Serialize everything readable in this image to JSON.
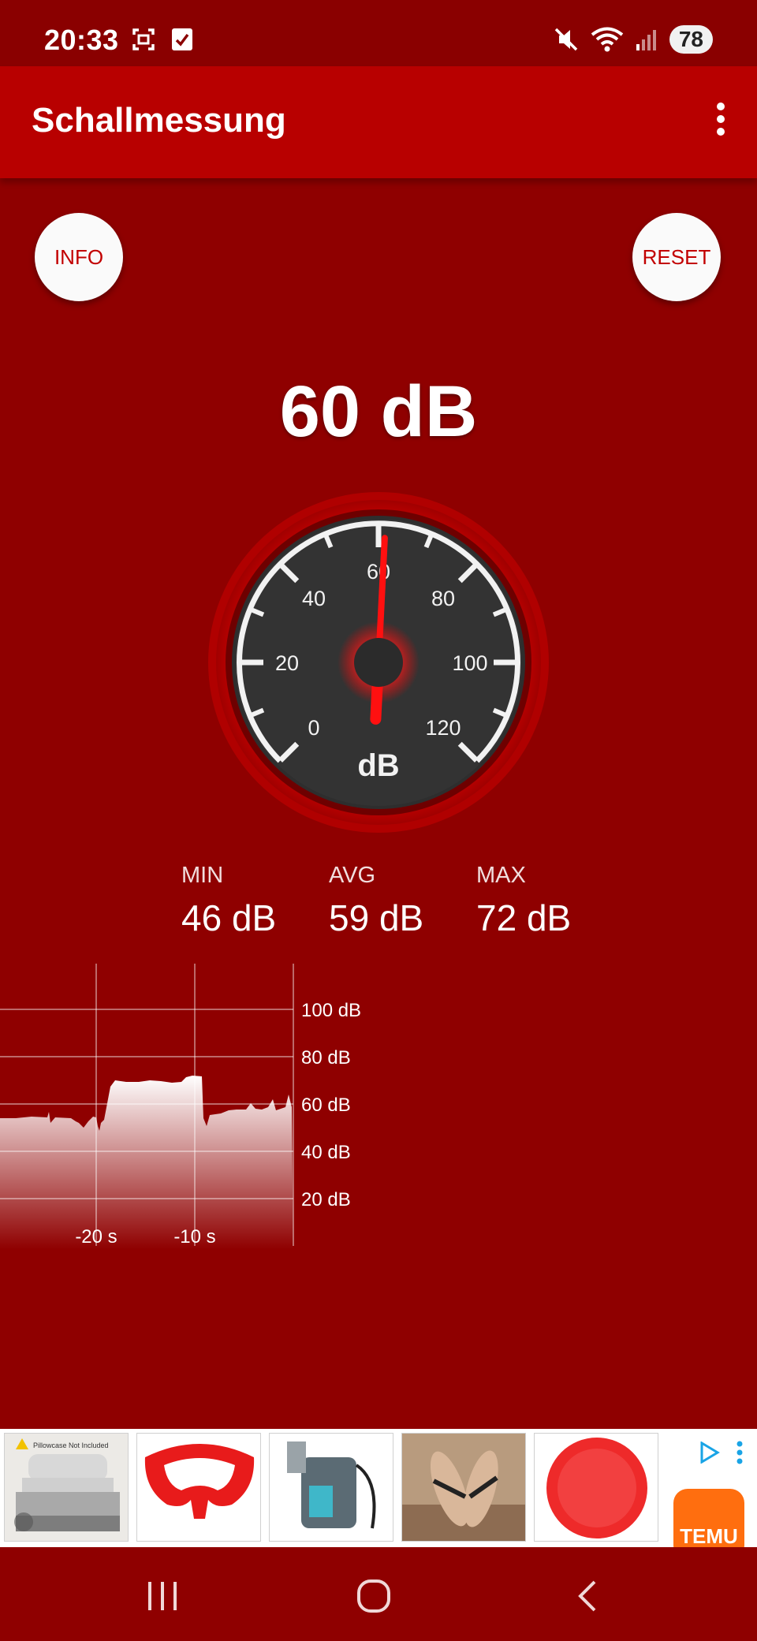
{
  "status_bar": {
    "time": "20:33",
    "battery": "78"
  },
  "app_bar": {
    "title": "Schallmessung"
  },
  "buttons": {
    "info": "INFO",
    "reset": "RESET"
  },
  "reading": {
    "value": "60 dB"
  },
  "gauge": {
    "labels": [
      "0",
      "20",
      "40",
      "60",
      "80",
      "100",
      "120"
    ],
    "unit": "dB",
    "needle_value": 60,
    "max": 120
  },
  "stats": [
    {
      "label": "MIN",
      "value": "46 dB"
    },
    {
      "label": "AVG",
      "value": "59 dB"
    },
    {
      "label": "MAX",
      "value": "72 dB"
    }
  ],
  "history": {
    "y_labels": [
      "100 dB",
      "80 dB",
      "60 dB",
      "40 dB",
      "20 dB"
    ],
    "x_labels": [
      "-20 s",
      "-10 s"
    ]
  },
  "ad": {
    "brand": "TEMU",
    "ad_item_1_text": "Pillowcase Not Included"
  },
  "colors": {
    "background": "#8f0000",
    "app_bar": "#b80000",
    "accent": "#c20000"
  }
}
